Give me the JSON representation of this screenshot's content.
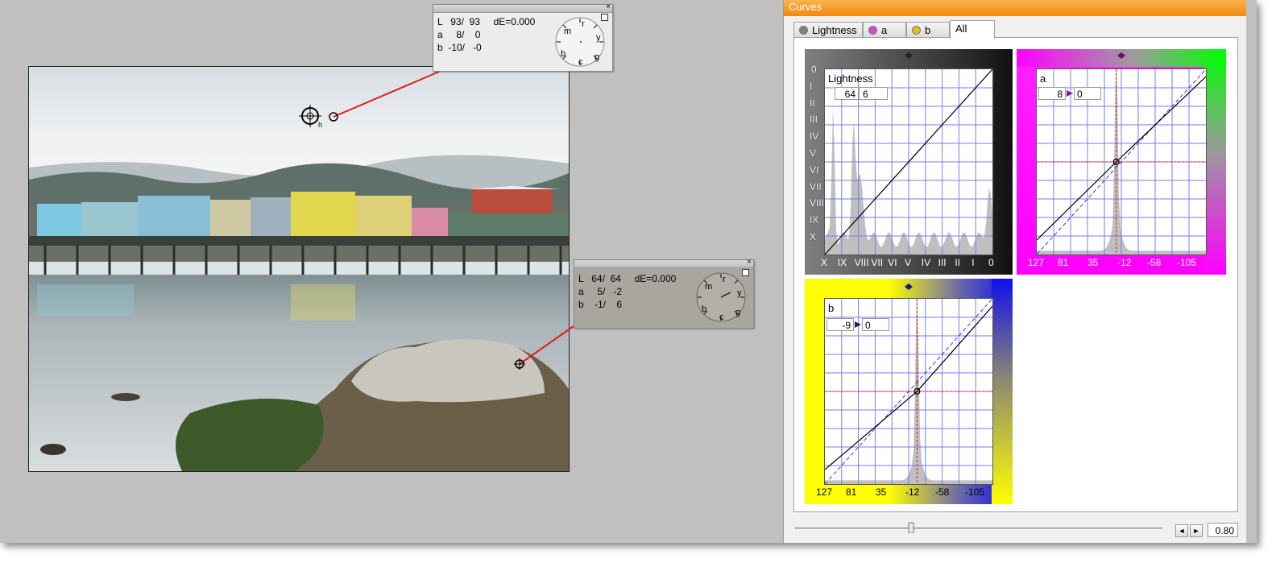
{
  "readout_top": {
    "close": "×",
    "rows": [
      "L   93/  93     dE=0.000",
      "a     8/    0",
      "b  -10/   -0"
    ],
    "dial": {
      "m": "m",
      "r": "r",
      "y": "y",
      "b": "b",
      "c": "c",
      "g": "g"
    }
  },
  "readout_bottom": {
    "close": "×",
    "rows": [
      "L   64/  64     dE=0.000",
      "a     5/   -2",
      "b    -1/    6"
    ],
    "dial": {
      "m": "m",
      "r": "r",
      "y": "y",
      "b": "b",
      "c": "c",
      "g": "g"
    }
  },
  "sampler_label": "h",
  "curves": {
    "title": "Curves",
    "tabs": [
      {
        "label": "Lightness",
        "dot_color": "#808080"
      },
      {
        "label": "a",
        "dot_color": "#d44ad4"
      },
      {
        "label": "b",
        "dot_color": "#d8c21a"
      },
      {
        "label": "All"
      }
    ],
    "lightness": {
      "label": "Lightness",
      "in_value": "64",
      "out_value": "6",
      "y_labels": [
        "0",
        "I",
        "II",
        "III",
        "IV",
        "V",
        "VI",
        "VII",
        "VIII",
        "IX",
        "X"
      ],
      "x_labels": [
        "X",
        "IX",
        "VIII",
        "VII",
        "VI",
        "V",
        "IV",
        "III",
        "II",
        "I",
        "0"
      ]
    },
    "a": {
      "label": "a",
      "in_value": "8",
      "out_value": "0",
      "x_labels": [
        "127",
        "81",
        "35",
        "-12",
        "-58",
        "-105"
      ]
    },
    "b": {
      "label": "b",
      "in_value": "-9",
      "out_value": "0",
      "x_labels": [
        "127",
        "81",
        "35",
        "-12",
        "-58",
        "-105"
      ]
    },
    "zoom": "0.80",
    "btn_left": "◄",
    "btn_right": "►"
  },
  "colors": {
    "grid": "#7a7af0",
    "curve": "#000000",
    "sample_line": "#e02020",
    "magenta": "#ff00ff",
    "green": "#00e000",
    "yellow": "#ffff00",
    "blue": "#1010ee"
  }
}
